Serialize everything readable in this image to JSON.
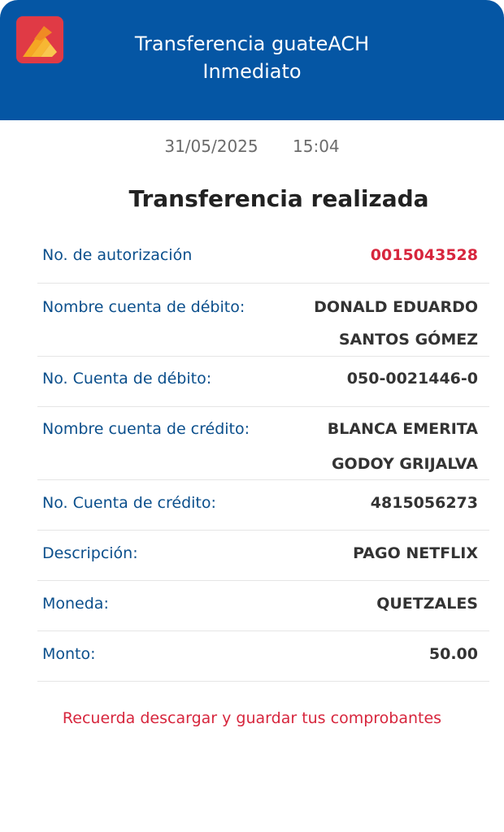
{
  "header": {
    "title_line1": "Transferencia guateACH",
    "title_line2": "Inmediato",
    "logo_icon": "bank-logo-icon",
    "accent_color": "#0556a4"
  },
  "datetime": {
    "date": "31/05/2025",
    "time": "15:04"
  },
  "result_title": "Transferencia realizada",
  "details": [
    {
      "label": "No. de autorización",
      "value": "0015043528"
    },
    {
      "label": "Nombre cuenta de débito:",
      "value_line1": "DONALD EDUARDO",
      "value_line2": "SANTOS GÓMEZ"
    },
    {
      "label": "No. Cuenta de débito:",
      "value": "050-0021446-0"
    },
    {
      "label": "Nombre cuenta de crédito:",
      "value_line1": "BLANCA EMERITA",
      "value_line2": "GODOY GRIJALVA"
    },
    {
      "label": "No. Cuenta de crédito:",
      "value": "4815056273"
    },
    {
      "label": "Descripción:",
      "value": "PAGO NETFLIX"
    },
    {
      "label": "Moneda:",
      "value": "QUETZALES"
    },
    {
      "label": "Monto:",
      "value": "50.00"
    }
  ],
  "reminder": "Recuerda descargar y guardar tus comprobantes",
  "colors": {
    "label": "#0b4f8c",
    "authorization": "#d7263d",
    "reminder": "#d7263d"
  }
}
